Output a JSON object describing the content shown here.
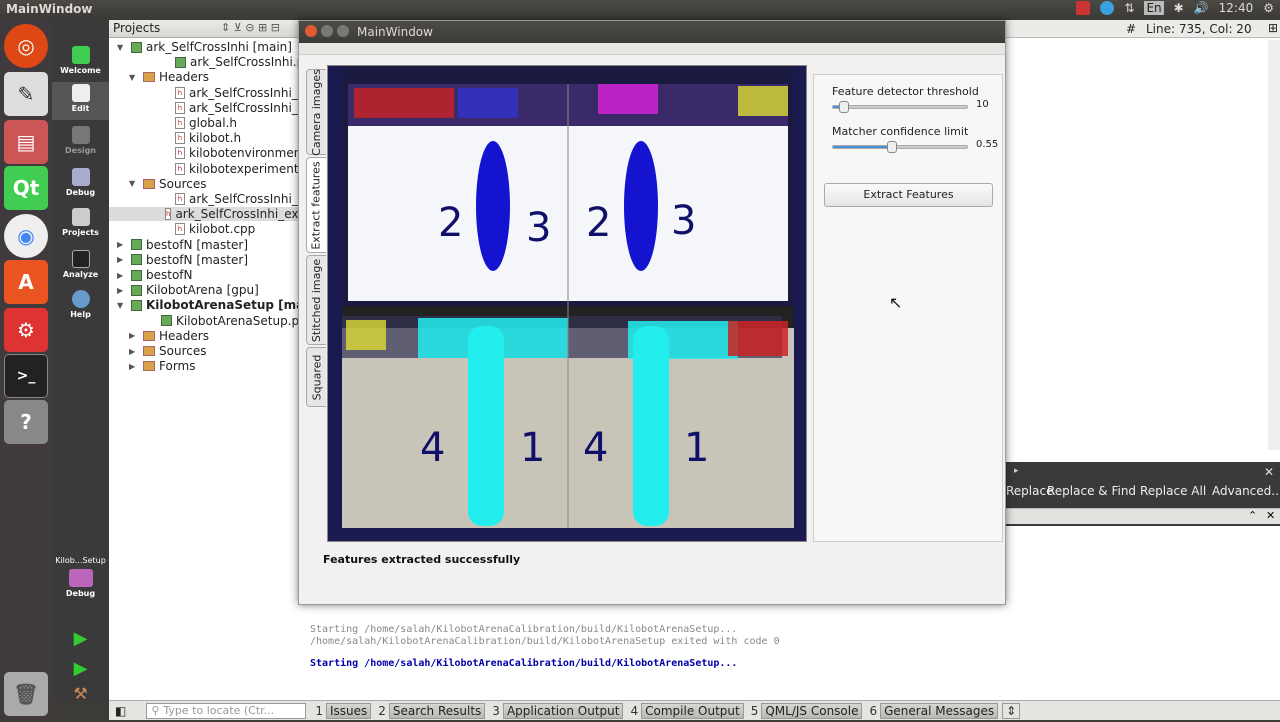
{
  "topbar": {
    "title": "MainWindow",
    "keyboard": "En",
    "time": "12:40"
  },
  "editor_header": {
    "line_col": "Line: 735, Col: 20"
  },
  "modes": [
    {
      "label": "Welcome"
    },
    {
      "label": "Edit"
    },
    {
      "label": "Design"
    },
    {
      "label": "Debug"
    },
    {
      "label": "Projects"
    },
    {
      "label": "Analyze"
    },
    {
      "label": "Help"
    }
  ],
  "kit_selector": {
    "project": "Kilob...Setup",
    "mode": "Debug"
  },
  "sidebar": {
    "title": "Projects",
    "items": [
      {
        "label": "ark_SelfCrossInhi [main]"
      },
      {
        "label": "ark_SelfCrossInhi.pro"
      },
      {
        "label": "Headers"
      },
      {
        "label": "ark_SelfCrossInhi_env.h"
      },
      {
        "label": "ark_SelfCrossInhi_exp.h"
      },
      {
        "label": "global.h"
      },
      {
        "label": "kilobot.h"
      },
      {
        "label": "kilobotenvironment.h"
      },
      {
        "label": "kilobotexperiment.h"
      },
      {
        "label": "Sources"
      },
      {
        "label": "ark_SelfCrossInhi_env.c"
      },
      {
        "label": "ark_SelfCrossInhi_exp.c"
      },
      {
        "label": "kilobot.cpp"
      },
      {
        "label": "bestofN [master]"
      },
      {
        "label": "bestofN [master]"
      },
      {
        "label": "bestofN"
      },
      {
        "label": "KilobotArena [gpu]"
      },
      {
        "label": "KilobotArenaSetup [master"
      },
      {
        "label": "KilobotArenaSetup.pro"
      },
      {
        "label": "Headers"
      },
      {
        "label": "Sources"
      },
      {
        "label": "Forms"
      }
    ]
  },
  "findbar": {
    "replace": "Replace",
    "replace_find": "Replace & Find",
    "replace_all": "Replace All",
    "advanced": "Advanced..."
  },
  "output": {
    "lines": [
      "Starting /home/salah/KilobotArenaCalibration/build/KilobotArenaSetup...",
      "/home/salah/KilobotArenaCalibration/build/KilobotArenaSetup exited with code 0",
      "Starting /home/salah/KilobotArenaCalibration/build/KilobotArenaSetup..."
    ]
  },
  "bottombar": {
    "locator_placeholder": "Type to locate (Ctr...",
    "tabs": [
      {
        "num": "1",
        "label": "Issues"
      },
      {
        "num": "2",
        "label": "Search Results"
      },
      {
        "num": "3",
        "label": "Application Output"
      },
      {
        "num": "4",
        "label": "Compile Output"
      },
      {
        "num": "5",
        "label": "QML/JS Console"
      },
      {
        "num": "6",
        "label": "General Messages"
      }
    ]
  },
  "mainwindow": {
    "title": "MainWindow",
    "tabs": [
      "Camera images",
      "Extract features",
      "Stitched image",
      "Squared"
    ],
    "threshold": {
      "label": "Feature detector threshold",
      "value": "10",
      "fraction": 0.08
    },
    "confidence": {
      "label": "Matcher confidence limit",
      "value": "0.55",
      "fraction": 0.44
    },
    "extract_button": "Extract Features",
    "status": "Features extracted successfully",
    "image_digits": [
      "2",
      "3",
      "2",
      "3",
      "4",
      "1",
      "4",
      "1"
    ]
  }
}
